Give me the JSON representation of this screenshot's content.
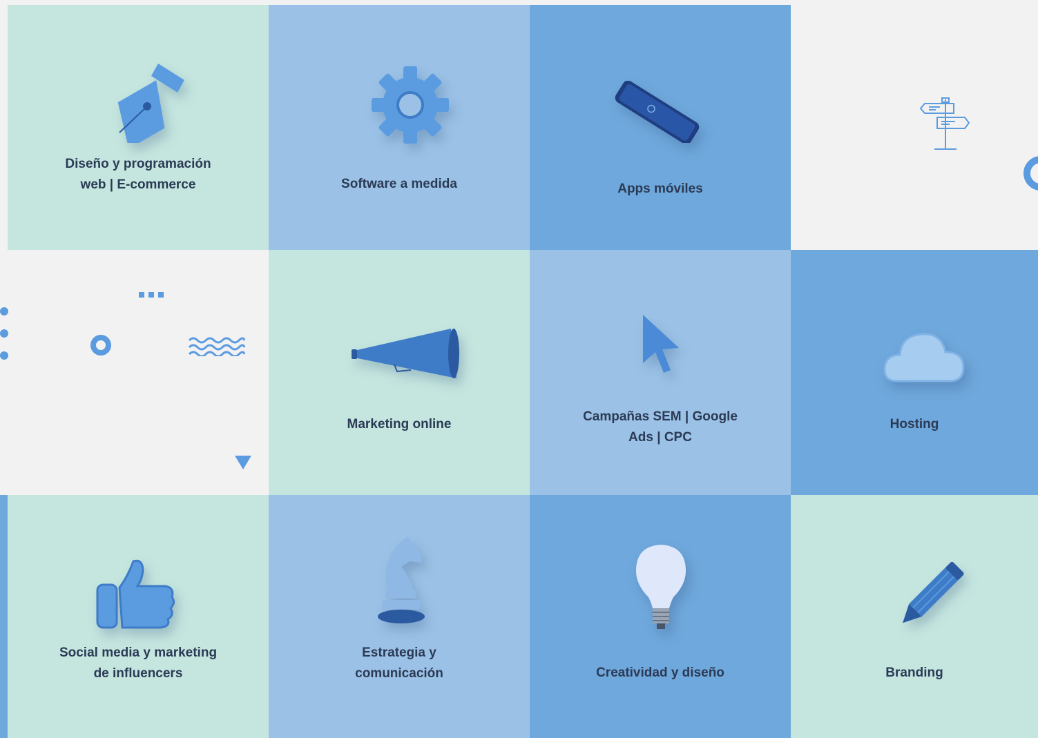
{
  "services": [
    {
      "label_line1": "Diseño y programación",
      "label_line2": "web | E-commerce"
    },
    {
      "label_line1": "Software a medida",
      "label_line2": ""
    },
    {
      "label_line1": "Apps móviles",
      "label_line2": ""
    },
    {
      "label_line1": "Marketing online",
      "label_line2": ""
    },
    {
      "label_line1": "Campañas SEM | Google",
      "label_line2": "Ads | CPC"
    },
    {
      "label_line1": "Hosting",
      "label_line2": ""
    },
    {
      "label_line1": "Social media y marketing",
      "label_line2": "de influencers"
    },
    {
      "label_line1": "Estrategia y",
      "label_line2": "comunicación"
    },
    {
      "label_line1": "Creatividad y diseño",
      "label_line2": ""
    },
    {
      "label_line1": "Branding",
      "label_line2": ""
    }
  ],
  "icons": [
    "pen-nib-icon",
    "gear-icon",
    "smartphone-icon",
    "megaphone-icon",
    "cursor-arrow-icon",
    "cloud-icon",
    "thumbs-up-icon",
    "chess-knight-icon",
    "lightbulb-icon",
    "pencil-icon",
    "signpost-icon"
  ],
  "colors": {
    "mint": "#c5e6df",
    "light_blue": "#9bc2e6",
    "mid_blue": "#6fa8dc",
    "grey": "#f2f2f2",
    "text": "#2b3a55",
    "accent": "#4a90d9"
  }
}
